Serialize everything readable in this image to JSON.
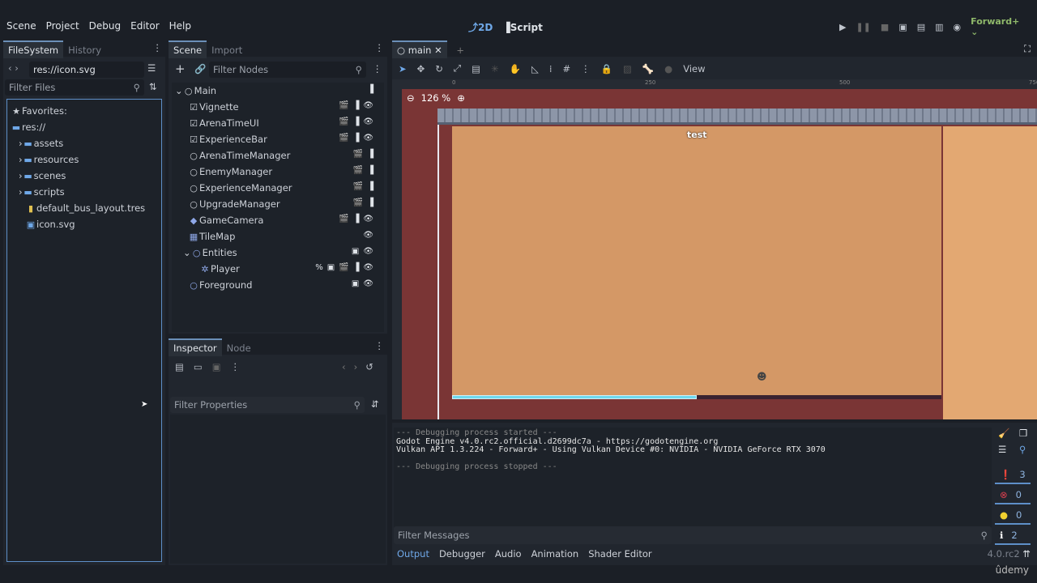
{
  "menu": [
    "Scene",
    "Project",
    "Debug",
    "Editor",
    "Help"
  ],
  "workspaces": {
    "two_d": "2D",
    "script": "Script"
  },
  "renderer": "Forward+",
  "filesystem": {
    "tabs": [
      "FileSystem",
      "History"
    ],
    "path": "res://icon.svg",
    "filter_placeholder": "Filter Files",
    "favorites": "Favorites:",
    "root": "res://",
    "items": [
      "assets",
      "resources",
      "scenes",
      "scripts",
      "default_bus_layout.tres",
      "icon.svg"
    ]
  },
  "scene": {
    "tabs": [
      "Scene",
      "Import"
    ],
    "filter_placeholder": "Filter Nodes",
    "nodes": [
      "Main",
      "Vignette",
      "ArenaTimeUI",
      "ExperienceBar",
      "ArenaTimeManager",
      "EnemyManager",
      "ExperienceManager",
      "UpgradeManager",
      "GameCamera",
      "TileMap",
      "Entities",
      "Player",
      "Foreground"
    ]
  },
  "inspector": {
    "tabs": [
      "Inspector",
      "Node"
    ],
    "filter_placeholder": "Filter Properties"
  },
  "editor": {
    "tab": "main",
    "view_label": "View",
    "zoom": "126 %",
    "ruler": [
      "0",
      "250",
      "500",
      "750"
    ],
    "label_text": "test",
    "experience_progress": 0.5
  },
  "output": {
    "lines": [
      "--- Debugging process started ---",
      "Godot Engine v4.0.rc2.official.d2699dc7a - https://godotengine.org",
      "Vulkan API 1.3.224 - Forward+ - Using Vulkan Device #0: NVIDIA - NVIDIA GeForce RTX 3070",
      "",
      "--- Debugging process stopped ---"
    ],
    "filter_placeholder": "Filter Messages",
    "counts": {
      "messages": "3",
      "errors": "0",
      "warnings": "0",
      "info": "2"
    },
    "tabs": [
      "Output",
      "Debugger",
      "Audio",
      "Animation",
      "Shader Editor"
    ],
    "version": "4.0.rc2"
  },
  "watermark": "ûdemy"
}
